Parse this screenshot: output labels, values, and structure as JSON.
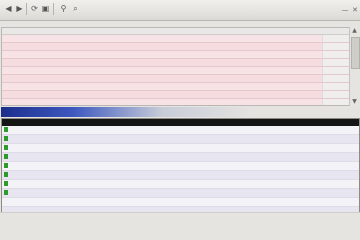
{
  "toolbar": {
    "icons": [
      "back-icon",
      "forward-icon",
      "refresh-icon",
      "save-icon",
      "export-icon",
      "find-icon",
      "filter-icon"
    ],
    "window_controls": [
      "minimize-icon",
      "close-icon"
    ]
  },
  "errors": {
    "header_left": "",
    "header_right": "",
    "rows": [
      {
        "msg": "",
        "time": ""
      },
      {
        "msg": "",
        "time": ""
      },
      {
        "msg": "",
        "time": ""
      },
      {
        "msg": "",
        "time": ""
      },
      {
        "msg": "",
        "time": ""
      },
      {
        "msg": "",
        "time": ""
      },
      {
        "msg": "",
        "time": ""
      },
      {
        "msg": "",
        "time": ""
      },
      {
        "msg": "",
        "time": ""
      },
      {
        "msg": "",
        "time": ""
      }
    ]
  },
  "splitter": {
    "label": ""
  },
  "log": {
    "rows": [
      {
        "text": ""
      },
      {
        "text": ""
      },
      {
        "text": ""
      },
      {
        "text": ""
      },
      {
        "text": ""
      },
      {
        "text": ""
      },
      {
        "text": ""
      },
      {
        "text": ""
      },
      {
        "text": ""
      },
      {
        "text": ""
      }
    ]
  },
  "status": {
    "text": ""
  },
  "colors": {
    "error_bg": "#f7e3e5",
    "log_ok": "#2f9a2c",
    "accent": "#1c2e8c"
  }
}
